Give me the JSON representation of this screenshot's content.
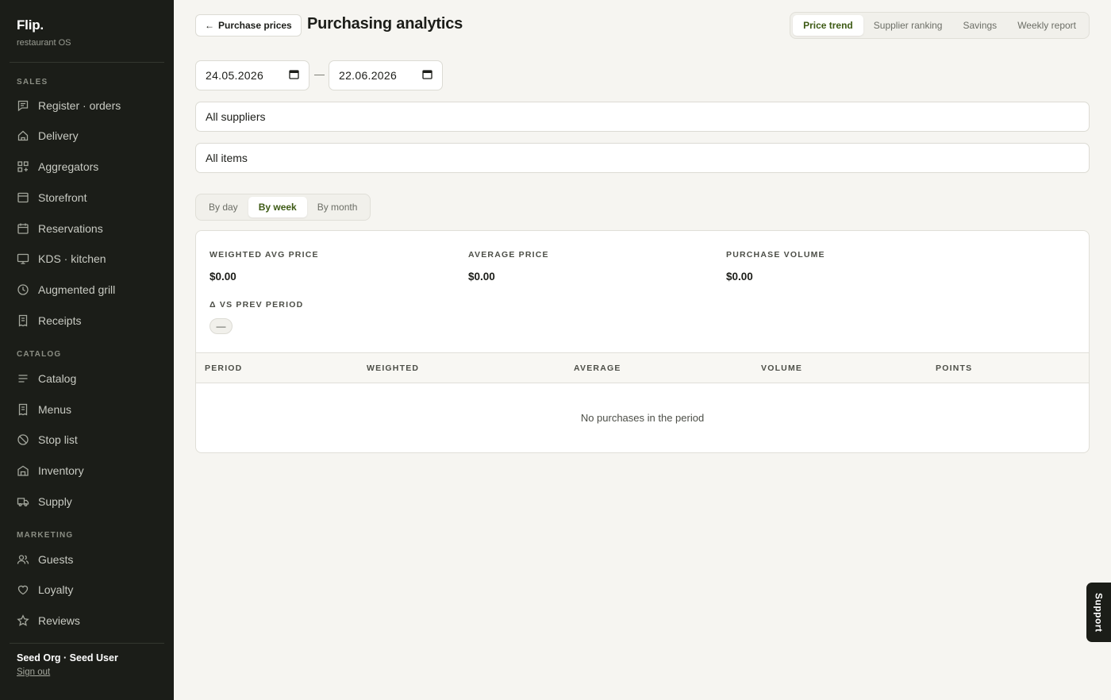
{
  "brand": {
    "name": "Flip.",
    "subtitle": "restaurant OS"
  },
  "sidebar": {
    "sections": [
      {
        "label": "SALES",
        "items": [
          {
            "label": "Register · orders",
            "icon": "receipt-chat-icon"
          },
          {
            "label": "Delivery",
            "icon": "home-icon"
          },
          {
            "label": "Aggregators",
            "icon": "grid-plus-icon"
          },
          {
            "label": "Storefront",
            "icon": "window-icon"
          },
          {
            "label": "Reservations",
            "icon": "calendar-icon"
          },
          {
            "label": "KDS · kitchen",
            "icon": "monitor-icon"
          },
          {
            "label": "Augmented grill",
            "icon": "clock-icon"
          },
          {
            "label": "Receipts",
            "icon": "receipt-icon"
          }
        ]
      },
      {
        "label": "CATALOG",
        "items": [
          {
            "label": "Catalog",
            "icon": "list-icon"
          },
          {
            "label": "Menus",
            "icon": "receipt-icon"
          },
          {
            "label": "Stop list",
            "icon": "ban-icon"
          },
          {
            "label": "Inventory",
            "icon": "warehouse-icon"
          },
          {
            "label": "Supply",
            "icon": "truck-icon"
          }
        ]
      },
      {
        "label": "MARKETING",
        "items": [
          {
            "label": "Guests",
            "icon": "users-icon"
          },
          {
            "label": "Loyalty",
            "icon": "heart-icon"
          },
          {
            "label": "Reviews",
            "icon": "star-icon"
          }
        ]
      }
    ],
    "user": {
      "name": "Seed Org · Seed User",
      "signout": "Sign out"
    }
  },
  "header": {
    "back_label": "Purchase prices",
    "title": "Purchasing analytics",
    "tabs": [
      {
        "label": "Price trend",
        "active": true
      },
      {
        "label": "Supplier ranking",
        "active": false
      },
      {
        "label": "Savings",
        "active": false
      },
      {
        "label": "Weekly report",
        "active": false
      }
    ]
  },
  "filters": {
    "date_from": "24.05.2026",
    "date_sep": "—",
    "date_to": "22.06.2026",
    "supplier": "All suppliers",
    "items": "All items"
  },
  "granularity": {
    "options": [
      {
        "label": "By day",
        "active": false
      },
      {
        "label": "By week",
        "active": true
      },
      {
        "label": "By month",
        "active": false
      }
    ]
  },
  "metrics": {
    "weighted_avg": {
      "label": "WEIGHTED AVG PRICE",
      "value": "$0.00"
    },
    "average": {
      "label": "AVERAGE PRICE",
      "value": "$0.00"
    },
    "volume": {
      "label": "PURCHASE VOLUME",
      "value": "$0.00"
    },
    "delta": {
      "label": "Δ VS PREV PERIOD",
      "value": "—"
    }
  },
  "table": {
    "columns": [
      "PERIOD",
      "WEIGHTED",
      "AVERAGE",
      "VOLUME",
      "POINTS"
    ],
    "empty_message": "No purchases in the period"
  },
  "support": {
    "label": "Support"
  },
  "colors": {
    "accent": "#3d5a14",
    "sidebar_bg": "#1b1d18",
    "page_bg": "#f6f5f1"
  }
}
